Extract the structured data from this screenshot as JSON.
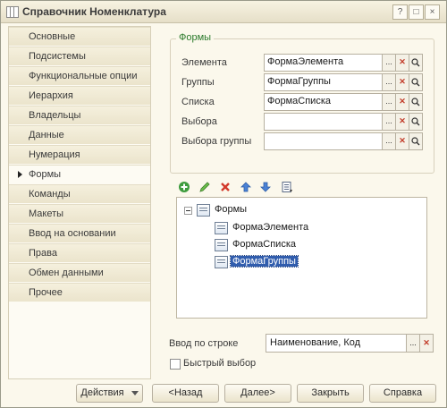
{
  "window": {
    "title": "Справочник Номенклатура",
    "controls": {
      "help": "?",
      "maximize": "□",
      "close": "×"
    }
  },
  "sidebar": {
    "items": [
      {
        "label": "Основные"
      },
      {
        "label": "Подсистемы"
      },
      {
        "label": "Функциональные опции"
      },
      {
        "label": "Иерархия"
      },
      {
        "label": "Владельцы"
      },
      {
        "label": "Данные"
      },
      {
        "label": "Нумерация"
      },
      {
        "label": "Формы"
      },
      {
        "label": "Команды"
      },
      {
        "label": "Макеты"
      },
      {
        "label": "Ввод на основании"
      },
      {
        "label": "Права"
      },
      {
        "label": "Обмен данными"
      },
      {
        "label": "Прочее"
      }
    ],
    "active_index": 7
  },
  "forms_group": {
    "title": "Формы",
    "fields": [
      {
        "label": "Элемента",
        "value": "ФормаЭлемента"
      },
      {
        "label": "Группы",
        "value": "ФормаГруппы"
      },
      {
        "label": "Списка",
        "value": "ФормаСписка"
      },
      {
        "label": "Выбора",
        "value": ""
      },
      {
        "label": "Выбора группы",
        "value": ""
      }
    ],
    "field_buttons": {
      "select": "...",
      "clear": "✕",
      "open": "🔍"
    }
  },
  "forms_toolbar": {
    "icons": [
      "add-icon",
      "edit-icon",
      "delete-icon",
      "move-up-icon",
      "move-down-icon",
      "list-icon"
    ]
  },
  "forms_tree": {
    "root": "Формы",
    "items": [
      {
        "label": "ФормаЭлемента"
      },
      {
        "label": "ФормаСписка"
      },
      {
        "label": "ФормаГруппы",
        "selected": true
      }
    ]
  },
  "input_by_string": {
    "label": "Ввод по строке",
    "value": "Наименование, Код"
  },
  "quick_select": {
    "label": "Быстрый выбор",
    "checked": false
  },
  "footer": {
    "actions": "Действия",
    "back": "<Назад",
    "next": "Далее>",
    "close": "Закрыть",
    "help": "Справка"
  },
  "colors": {
    "window_bg": "#fbf8ec",
    "accent_green": "#2b7a2b",
    "selection": "#315dad"
  }
}
